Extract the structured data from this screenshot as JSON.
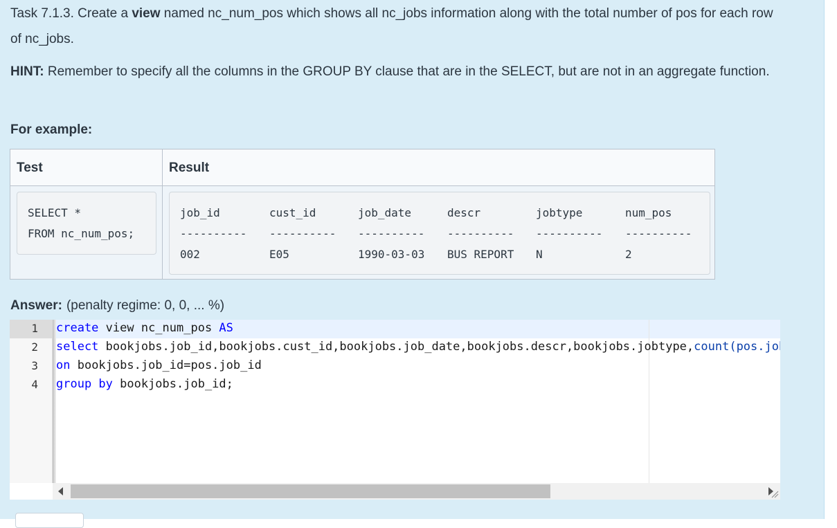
{
  "question": {
    "p1_prefix": "Task 7.1.3. Create a ",
    "p1_bold": "view",
    "p1_suffix": " named nc_num_pos which shows all nc_jobs information along with the total number of pos for each row of nc_jobs.",
    "hint_label": "HINT:",
    "hint_text": " Remember to specify all the columns in the GROUP BY clause that are in the SELECT, but are not in an aggregate function.",
    "example_label": "For example:"
  },
  "example": {
    "headers": {
      "test": "Test",
      "result": "Result"
    },
    "test_lines": [
      "SELECT *",
      "FROM nc_num_pos;"
    ],
    "result_columns": [
      "job_id",
      "cust_id",
      "job_date",
      "descr",
      "jobtype",
      "num_pos"
    ],
    "result_separator": "----------",
    "result_row": [
      "002",
      "E05",
      "1990-03-03",
      "BUS REPORT",
      "N",
      "2"
    ]
  },
  "answer": {
    "label": "Answer:",
    "penalty": "(penalty regime: 0, 0, ... %)",
    "line_numbers": [
      "1",
      "2",
      "3",
      "4"
    ],
    "code": {
      "l1_kw": "create",
      "l1_mid": " view nc_num_pos ",
      "l1_kw2": "AS",
      "l2_kw": "select",
      "l2_mid": " bookjobs.job_id,bookjobs.cust_id,bookjobs.job_date,bookjobs.descr,bookjobs.jobtype,",
      "l2_fn": "count(pos.job_id) as num_pos from bookjobs left join pos",
      "l3_kw": "on",
      "l3_mid": " bookjobs.job_id=pos.job_id",
      "l4_kw": "group by",
      "l4_mid": " bookjobs.job_id;"
    }
  },
  "colors": {
    "panel_bg": "#d9edf7",
    "keyword": "#0000ff"
  }
}
